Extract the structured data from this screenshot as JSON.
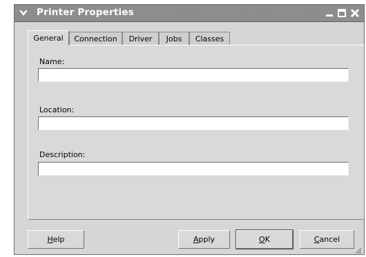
{
  "window": {
    "title": "Printer Properties",
    "menu_icon": "chevron-down-icon",
    "controls": [
      "minimize-icon",
      "maximize-icon",
      "close-icon"
    ]
  },
  "tabs": [
    {
      "label": "General",
      "active": true
    },
    {
      "label": "Connection",
      "active": false
    },
    {
      "label": "Driver",
      "active": false
    },
    {
      "label": "Jobs",
      "active": false
    },
    {
      "label": "Classes",
      "active": false
    }
  ],
  "fields": {
    "name": {
      "label": "Name:",
      "value": ""
    },
    "location": {
      "label": "Location:",
      "value": ""
    },
    "description": {
      "label": "Description:",
      "value": ""
    }
  },
  "buttons": {
    "help": {
      "mnemonic": "H",
      "rest": "elp"
    },
    "apply": {
      "mnemonic": "A",
      "rest": "pply"
    },
    "ok": {
      "mnemonic": "O",
      "rest": "K"
    },
    "cancel": {
      "mnemonic": "C",
      "rest": "ancel"
    }
  }
}
